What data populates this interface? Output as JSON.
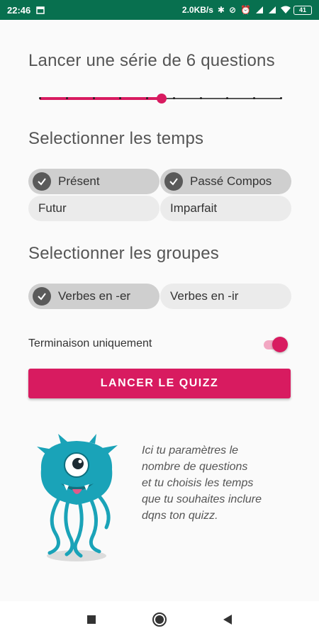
{
  "statusbar": {
    "time": "22:46",
    "speed": "2.0KB/s",
    "battery": "41"
  },
  "questions": {
    "title": "Lancer une série de 6 questions",
    "slider": {
      "min": 1,
      "max": 10,
      "value": 6
    }
  },
  "tenses": {
    "title": "Selectionner les temps",
    "chips": [
      {
        "label": "Présent",
        "selected": true
      },
      {
        "label": "Passé Compos",
        "selected": true
      },
      {
        "label": "Futur",
        "selected": false
      },
      {
        "label": "Imparfait",
        "selected": false
      }
    ]
  },
  "groups": {
    "title": "Selectionner les groupes",
    "chips": [
      {
        "label": "Verbes en -er",
        "selected": true
      },
      {
        "label": "Verbes en -ir",
        "selected": false
      }
    ]
  },
  "toggle": {
    "label": "Terminaison uniquement",
    "on": true
  },
  "cta": {
    "label": "LANCER LE QUIZZ"
  },
  "help": {
    "text_lines": [
      "Ici tu paramètres le",
      "nombre de questions",
      "et tu choisis les temps",
      "que tu souhaites inclure",
      "dqns ton quizz."
    ]
  },
  "colors": {
    "accent": "#d81b60",
    "statusbar": "#08704f",
    "monster": "#1aa3b8"
  }
}
